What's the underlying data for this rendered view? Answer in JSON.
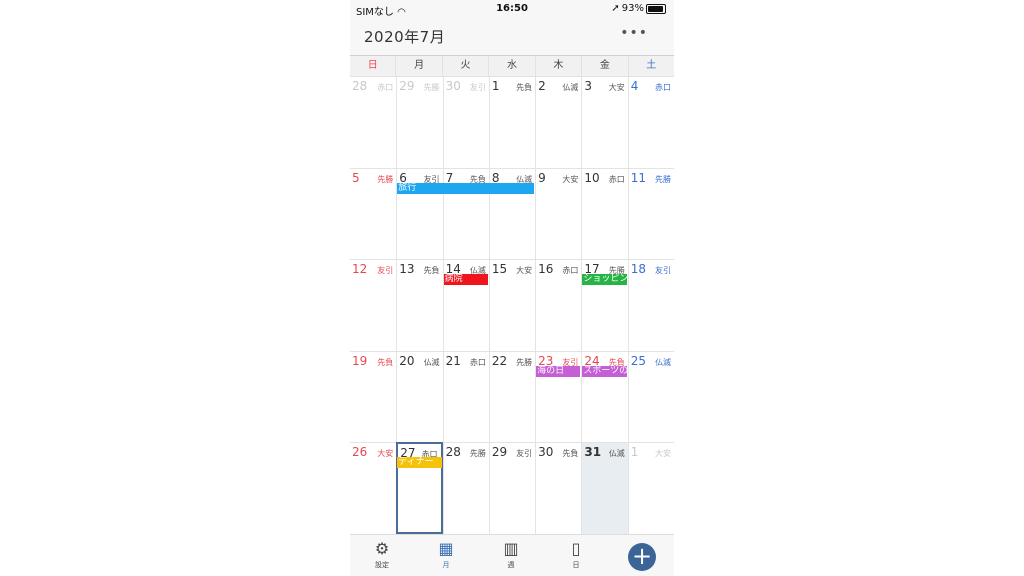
{
  "status": {
    "carrier": "SIMなし",
    "time": "16:50",
    "battery": "93%",
    "battery_level": 0.93
  },
  "header": {
    "title": "2020年7月",
    "more": "•••"
  },
  "weekdays": [
    "日",
    "月",
    "火",
    "水",
    "木",
    "金",
    "土"
  ],
  "weeks": [
    [
      {
        "d": "28",
        "r": "赤口",
        "t": "other"
      },
      {
        "d": "29",
        "r": "先勝",
        "t": "other"
      },
      {
        "d": "30",
        "r": "友引",
        "t": "other"
      },
      {
        "d": "1",
        "r": "先負",
        "t": ""
      },
      {
        "d": "2",
        "r": "仏滅",
        "t": ""
      },
      {
        "d": "3",
        "r": "大安",
        "t": ""
      },
      {
        "d": "4",
        "r": "赤口",
        "t": "sat"
      }
    ],
    [
      {
        "d": "5",
        "r": "先勝",
        "t": "sun"
      },
      {
        "d": "6",
        "r": "友引",
        "t": ""
      },
      {
        "d": "7",
        "r": "先負",
        "t": ""
      },
      {
        "d": "8",
        "r": "仏滅",
        "t": ""
      },
      {
        "d": "9",
        "r": "大安",
        "t": ""
      },
      {
        "d": "10",
        "r": "赤口",
        "t": ""
      },
      {
        "d": "11",
        "r": "先勝",
        "t": "sat"
      }
    ],
    [
      {
        "d": "12",
        "r": "友引",
        "t": "sun"
      },
      {
        "d": "13",
        "r": "先負",
        "t": ""
      },
      {
        "d": "14",
        "r": "仏滅",
        "t": ""
      },
      {
        "d": "15",
        "r": "大安",
        "t": ""
      },
      {
        "d": "16",
        "r": "赤口",
        "t": ""
      },
      {
        "d": "17",
        "r": "先勝",
        "t": ""
      },
      {
        "d": "18",
        "r": "友引",
        "t": "sat"
      }
    ],
    [
      {
        "d": "19",
        "r": "先負",
        "t": "sun"
      },
      {
        "d": "20",
        "r": "仏滅",
        "t": ""
      },
      {
        "d": "21",
        "r": "赤口",
        "t": ""
      },
      {
        "d": "22",
        "r": "先勝",
        "t": ""
      },
      {
        "d": "23",
        "r": "友引",
        "t": "hol"
      },
      {
        "d": "24",
        "r": "先負",
        "t": "hol"
      },
      {
        "d": "25",
        "r": "仏滅",
        "t": "sat"
      }
    ],
    [
      {
        "d": "26",
        "r": "大安",
        "t": "sun"
      },
      {
        "d": "27",
        "r": "赤口",
        "t": "selected"
      },
      {
        "d": "28",
        "r": "先勝",
        "t": ""
      },
      {
        "d": "29",
        "r": "友引",
        "t": ""
      },
      {
        "d": "30",
        "r": "先負",
        "t": ""
      },
      {
        "d": "31",
        "r": "仏滅",
        "t": "today"
      },
      {
        "d": "1",
        "r": "大安",
        "t": "other"
      }
    ]
  ],
  "events": [
    {
      "title": "旅行",
      "week": 1,
      "start": 1,
      "span": 3,
      "color": "#1ea7f0"
    },
    {
      "title": "病院",
      "week": 2,
      "start": 2,
      "span": 1,
      "color": "#f0141e"
    },
    {
      "title": "ショッピング",
      "week": 2,
      "start": 5,
      "span": 1,
      "color": "#27b446"
    },
    {
      "title": "海の日",
      "week": 3,
      "start": 4,
      "span": 1,
      "color": "#c45fd6"
    },
    {
      "title": "スポーツの日",
      "week": 3,
      "start": 5,
      "span": 1,
      "color": "#c45fd6"
    },
    {
      "title": "ディナー",
      "week": 4,
      "start": 1,
      "span": 1,
      "color": "#f5c20a"
    }
  ],
  "tabs": [
    {
      "label": "設定",
      "icon": "gear-icon"
    },
    {
      "label": "月",
      "icon": "month-icon",
      "active": true
    },
    {
      "label": "週",
      "icon": "week-icon"
    },
    {
      "label": "日",
      "icon": "day-icon"
    }
  ],
  "add_label": "+"
}
